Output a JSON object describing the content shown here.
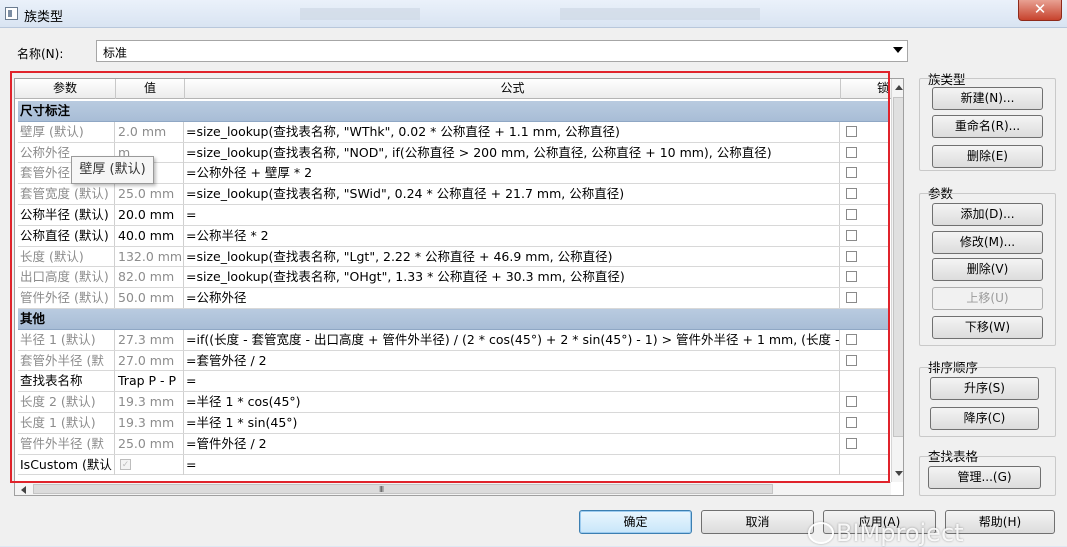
{
  "window": {
    "title": "族类型",
    "close_label": "✕"
  },
  "name": {
    "label": "名称(N):",
    "value": "标准"
  },
  "columns": [
    "参数",
    "值",
    "公式",
    "锁"
  ],
  "groups": [
    {
      "label": "尺寸标注",
      "rows": [
        {
          "param": "壁厚 (默认)",
          "value": "2.0 mm",
          "formula": "=size_lookup(查找表名称, \"WThk\", 0.02 * 公称直径 + 1.1 mm, 公称直径)",
          "dim": true,
          "lock": true
        },
        {
          "param": "公称外径",
          "value": "m",
          "formula": "=size_lookup(查找表名称, \"NOD\", if(公称直径 > 200 mm, 公称直径, 公称直径 + 10 mm), 公称直径)",
          "dim": true,
          "lock": true
        },
        {
          "param": "套管外径",
          "value": "m",
          "formula": "=公称外径 + 壁厚 * 2",
          "dim": true,
          "lock": true
        },
        {
          "param": "套管宽度 (默认)",
          "value": "25.0 mm",
          "formula": "=size_lookup(查找表名称, \"SWid\", 0.24 * 公称直径 + 21.7 mm, 公称直径)",
          "dim": true,
          "lock": true
        },
        {
          "param": "公称半径 (默认)",
          "value": "20.0 mm",
          "formula": "=",
          "dim": false,
          "lock": true
        },
        {
          "param": "公称直径 (默认)",
          "value": "40.0 mm",
          "formula": "=公称半径 * 2",
          "dim": false,
          "lock": true
        },
        {
          "param": "长度 (默认)",
          "value": "132.0 mm",
          "formula": "=size_lookup(查找表名称, \"Lgt\", 2.22 * 公称直径 + 46.9 mm, 公称直径)",
          "dim": true,
          "lock": true
        },
        {
          "param": "出口高度 (默认)",
          "value": "82.0 mm",
          "formula": "=size_lookup(查找表名称, \"OHgt\", 1.33 * 公称直径 + 30.3 mm, 公称直径)",
          "dim": true,
          "lock": true
        },
        {
          "param": "管件外径 (默认)",
          "value": "50.0 mm",
          "formula": "=公称外径",
          "dim": true,
          "lock": true
        }
      ]
    },
    {
      "label": "其他",
      "rows": [
        {
          "param": "半径 1 (默认)",
          "value": "27.3 mm",
          "formula": "=if((长度 - 套管宽度 - 出口高度 + 管件外半径) / (2 * cos(45°) + 2 * sin(45°) - 1) > 管件外半径 + 1 mm, (长度 - 套",
          "dim": true,
          "lock": true
        },
        {
          "param": "套管外半径 (默",
          "value": "27.0 mm",
          "formula": "=套管外径 / 2",
          "dim": true,
          "lock": true
        },
        {
          "param": "查找表名称",
          "value": "Trap P - P",
          "formula": "=",
          "dim": false,
          "lock": false
        },
        {
          "param": "长度 2 (默认)",
          "value": "19.3 mm",
          "formula": "=半径 1 * cos(45°)",
          "dim": true,
          "lock": true
        },
        {
          "param": "长度 1 (默认)",
          "value": "19.3 mm",
          "formula": "=半径 1 * sin(45°)",
          "dim": true,
          "lock": true
        },
        {
          "param": "管件外半径 (默",
          "value": "25.0 mm",
          "formula": "=管件外径 / 2",
          "dim": true,
          "lock": true
        },
        {
          "param": "IsCustom (默认",
          "value": "✓",
          "formula": "=",
          "dim": false,
          "lock": false
        }
      ]
    }
  ],
  "tooltip": "壁厚 (默认)",
  "hscroll_grip": "III",
  "sections": {
    "family_types": {
      "label": "族类型",
      "buttons": [
        "新建(N)...",
        "重命名(R)...",
        "删除(E)"
      ]
    },
    "parameters": {
      "label": "参数",
      "buttons": [
        "添加(D)...",
        "修改(M)...",
        "删除(V)",
        "上移(U)",
        "下移(W)"
      ]
    },
    "sort": {
      "label": "排序顺序",
      "buttons": [
        "升序(S)",
        "降序(C)"
      ]
    },
    "lookup": {
      "label": "查找表格",
      "buttons": [
        "管理...(G)"
      ]
    }
  },
  "footer": {
    "ok": "确定",
    "cancel": "取消",
    "apply": "应用(A)",
    "help": "帮助(H)"
  },
  "watermark": "BIMproject"
}
